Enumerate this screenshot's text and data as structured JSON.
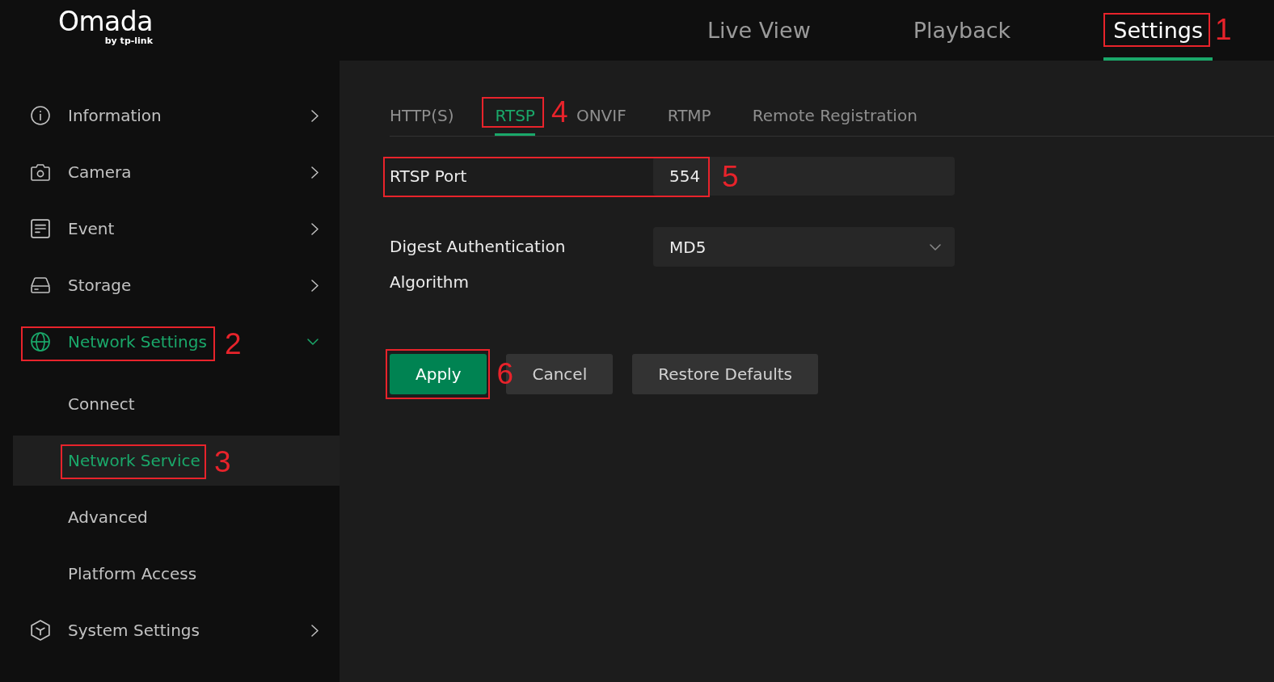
{
  "logo": {
    "name": "Omada",
    "tagline": "by tp-link"
  },
  "top_nav": [
    {
      "label": "Live View",
      "selected": false
    },
    {
      "label": "Playback",
      "selected": false
    },
    {
      "label": "Settings",
      "selected": true,
      "callout": "1"
    }
  ],
  "sidebar": {
    "items": [
      {
        "label": "Information",
        "selected": false,
        "expanded": false
      },
      {
        "label": "Camera",
        "selected": false,
        "expanded": false
      },
      {
        "label": "Event",
        "selected": false,
        "expanded": false
      },
      {
        "label": "Storage",
        "selected": false,
        "expanded": false
      },
      {
        "label": "Network Settings",
        "selected": true,
        "expanded": true,
        "callout": "2",
        "children": [
          {
            "label": "Connect",
            "selected": false
          },
          {
            "label": "Network Service",
            "selected": true,
            "callout": "3"
          },
          {
            "label": "Advanced",
            "selected": false
          },
          {
            "label": "Platform Access",
            "selected": false
          }
        ]
      },
      {
        "label": "System Settings",
        "selected": false,
        "expanded": false
      }
    ]
  },
  "tabs": [
    {
      "label": "HTTP(S)",
      "selected": false
    },
    {
      "label": "RTSP",
      "selected": true,
      "callout": "4"
    },
    {
      "label": "ONVIF",
      "selected": false
    },
    {
      "label": "RTMP",
      "selected": false
    },
    {
      "label": "Remote Registration",
      "selected": false
    }
  ],
  "form": {
    "fields": [
      {
        "kind": "input",
        "label": "RTSP Port",
        "value": "554",
        "callout": "5"
      },
      {
        "kind": "select",
        "label": "Digest Authentication Algorithm",
        "value": "MD5"
      }
    ]
  },
  "buttons": [
    {
      "kind": "primary",
      "label": "Apply",
      "callout": "6"
    },
    {
      "kind": "secondary",
      "label": "Cancel"
    },
    {
      "kind": "secondary",
      "label": "Restore Defaults"
    }
  ]
}
